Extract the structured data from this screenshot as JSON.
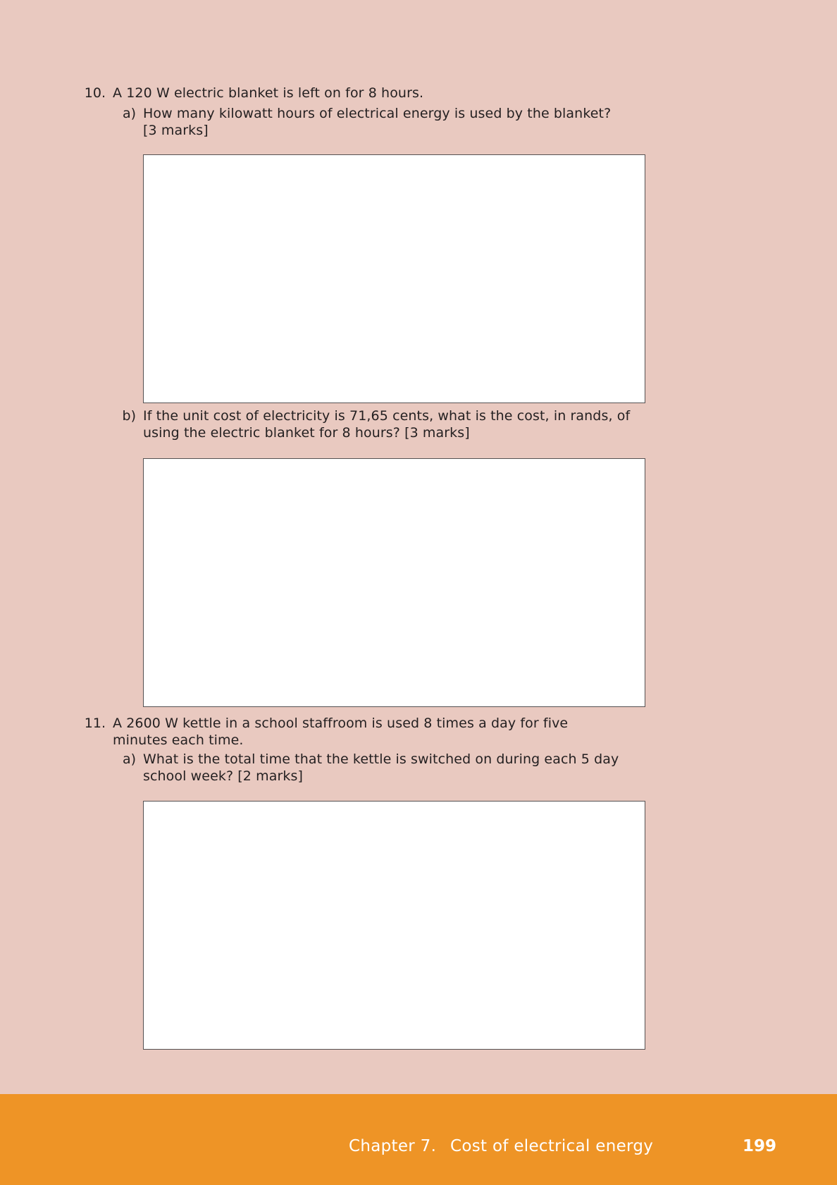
{
  "questions": [
    {
      "number": "10.",
      "text": [
        "A 120 W electric blanket is left on for 8 hours."
      ],
      "parts": [
        {
          "label": "a)",
          "text": [
            "How many kilowatt hours of electrical energy is used by the blanket?",
            "[3 marks]"
          ]
        },
        {
          "label": "b)",
          "text": [
            "If the unit cost of electricity is 71,65 cents, what is the cost, in rands, of",
            "using the electric blanket for 8 hours? [3 marks]"
          ]
        }
      ]
    },
    {
      "number": "11.",
      "text": [
        "A 2600 W kettle in a school staffroom is used 8 times a day for five",
        "minutes each time."
      ],
      "parts": [
        {
          "label": "a)",
          "text": [
            "What is the total time that the kettle is switched on during each 5 day",
            "school week? [2 marks]"
          ]
        }
      ]
    }
  ],
  "footer": {
    "chapter": "Chapter 7.",
    "title": "Cost of electrical energy",
    "page_number": "199"
  },
  "colors": {
    "page_background": "#e9c9c0",
    "footer_background": "#ee9426",
    "answer_box_border": "#555152"
  }
}
